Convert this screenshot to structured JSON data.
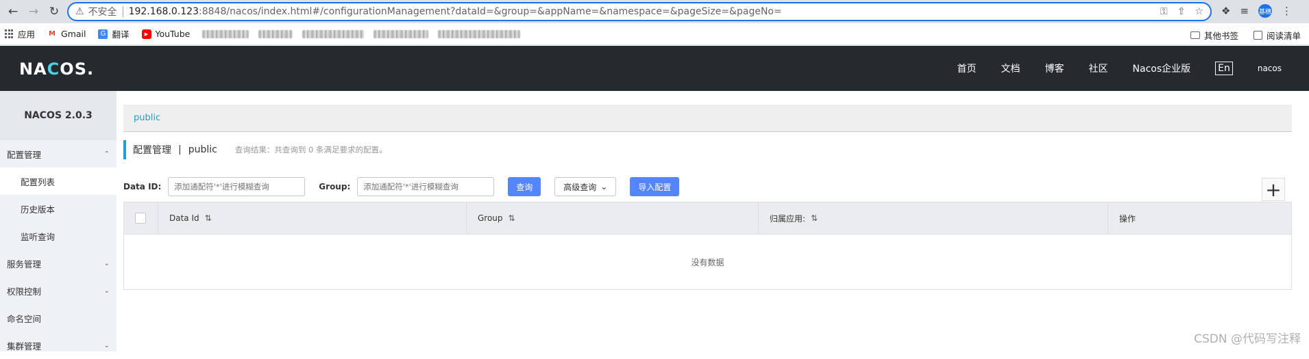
{
  "browser": {
    "insecure_label": "不安全",
    "url_host": "192.168.0.123",
    "url_rest": ":8848/nacos/index.html#/configurationManagement?dataId=&group=&appName=&namespace=&pageSize=&pageNo=",
    "avatar_text": "基穗"
  },
  "bookmarks": {
    "items": [
      "应用",
      "Gmail",
      "翻译",
      "YouTube"
    ],
    "others": "其他书签",
    "reading_list": "阅读清单"
  },
  "header": {
    "logo": "NACOS.",
    "nav": [
      "首页",
      "文档",
      "博客",
      "社区",
      "Nacos企业版"
    ],
    "lang": "En",
    "user": "nacos"
  },
  "sidebar": {
    "title": "NACOS 2.0.3",
    "groups": [
      {
        "label": "配置管理",
        "expanded": true,
        "children": [
          "配置列表",
          "历史版本",
          "监听查询"
        ]
      },
      {
        "label": "服务管理",
        "expanded": false
      },
      {
        "label": "权限控制",
        "expanded": false
      },
      {
        "label": "命名空间"
      },
      {
        "label": "集群管理",
        "expanded": false
      }
    ]
  },
  "main": {
    "namespace_tab": "public",
    "breadcrumb_title": "配置管理",
    "breadcrumb_sep": "|",
    "breadcrumb_ns": "public",
    "result_text": "查询结果：共查询到 0 条满足要求的配置。",
    "filters": {
      "dataid_label": "Data ID:",
      "dataid_placeholder": "添加通配符'*'进行模糊查询",
      "group_label": "Group:",
      "group_placeholder": "添加通配符'*'进行模糊查询",
      "query_button": "查询",
      "advanced_button": "高级查询",
      "import_button": "导入配置",
      "add_button": "+"
    },
    "table": {
      "columns": [
        "Data Id",
        "Group",
        "归属应用:",
        "操作"
      ],
      "empty_text": "没有数据"
    }
  },
  "watermark": "CSDN @代码写注释"
}
